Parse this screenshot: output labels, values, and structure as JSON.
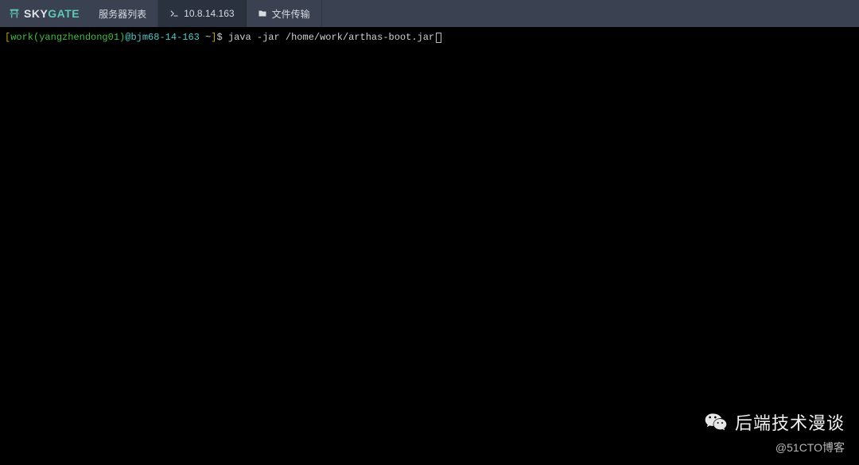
{
  "header": {
    "logo_sky": "SKY",
    "logo_gate": "GATE",
    "tabs": [
      {
        "label": "服务器列表",
        "icon": null,
        "active": false
      },
      {
        "label": "10.8.14.163",
        "icon": "terminal",
        "active": true
      },
      {
        "label": "文件传输",
        "icon": "folder",
        "active": false
      }
    ]
  },
  "terminal": {
    "prompt": {
      "open_bracket": "[",
      "user": "work",
      "user_paren_open": "(",
      "user_detail": "yangzhendong01",
      "user_paren_close": ")",
      "at": "@",
      "host": "bjm68-14-163",
      "cwd": " ~",
      "close_bracket": "]",
      "symbol": "$ "
    },
    "command": "java -jar /home/work/arthas-boot.jar"
  },
  "watermark": {
    "title": "后端技术漫谈",
    "subtitle": "@51CTO博客"
  }
}
